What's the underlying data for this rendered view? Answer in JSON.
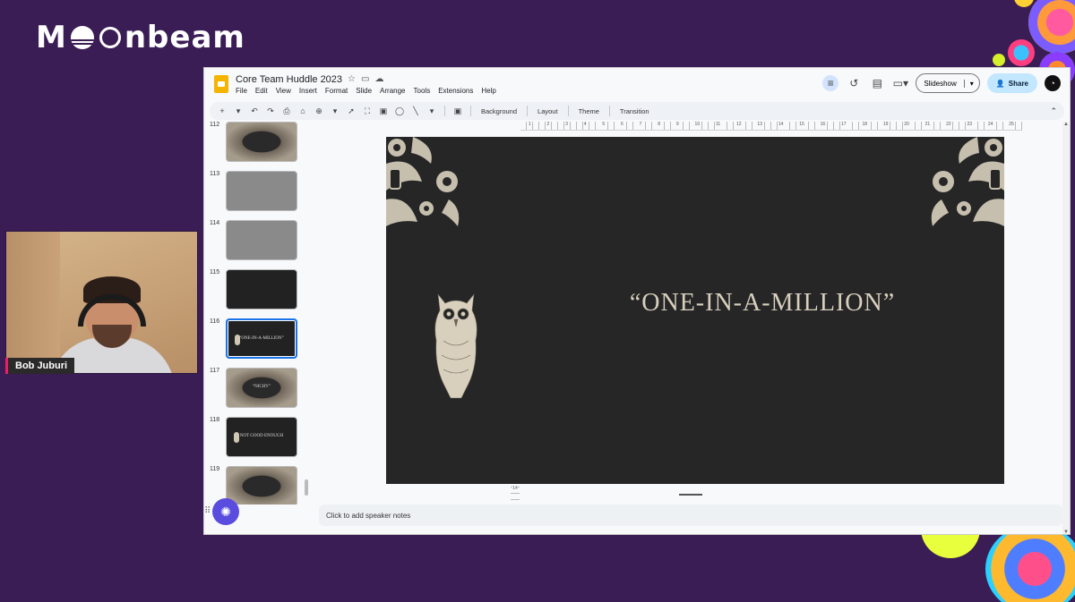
{
  "brand": {
    "logo_text_1": "M",
    "logo_text_2": "nbeam"
  },
  "participant": {
    "name": "Bob Juburi"
  },
  "document": {
    "title": "Core Team Huddle 2023",
    "menu": [
      "File",
      "Edit",
      "View",
      "Insert",
      "Format",
      "Slide",
      "Arrange",
      "Tools",
      "Extensions",
      "Help"
    ]
  },
  "header_actions": {
    "slideshow_label": "Slideshow",
    "share_label": "Share"
  },
  "toolbar": {
    "labels": [
      "Background",
      "Layout",
      "Theme",
      "Transition"
    ]
  },
  "ruler": {
    "h_ticks": [
      "1",
      "2",
      "3",
      "4",
      "5",
      "6",
      "7",
      "8",
      "9",
      "10",
      "11",
      "12",
      "13",
      "14",
      "15",
      "16",
      "17",
      "18",
      "19",
      "20",
      "21",
      "22",
      "23",
      "24",
      "25"
    ],
    "v_ticks": [
      "1",
      "2",
      "3",
      "4",
      "5",
      "6",
      "7",
      "8",
      "9",
      "10",
      "11",
      "12",
      "13",
      "14"
    ]
  },
  "slides": [
    {
      "number": "112",
      "style": "orn",
      "text": ""
    },
    {
      "number": "113",
      "style": "gray",
      "text": ""
    },
    {
      "number": "114",
      "style": "gray",
      "text": ""
    },
    {
      "number": "115",
      "style": "dark",
      "text": ""
    },
    {
      "number": "116",
      "style": "dark",
      "text": "“ONE-IN-A-MILLION”",
      "selected": true
    },
    {
      "number": "117",
      "style": "orn",
      "text": "“NICHY”"
    },
    {
      "number": "118",
      "style": "dark",
      "text": "NOT GOOD ENOUGH"
    },
    {
      "number": "119",
      "style": "orn",
      "text": ""
    }
  ],
  "current_slide": {
    "title": "“ONE-IN-A-MILLION”"
  },
  "notes": {
    "placeholder": "Click to add speaker notes"
  },
  "colors": {
    "background": "#3b1d55",
    "slide_bg": "#262627",
    "accent": "#1a73e8",
    "share_bg": "#c2e7ff"
  }
}
